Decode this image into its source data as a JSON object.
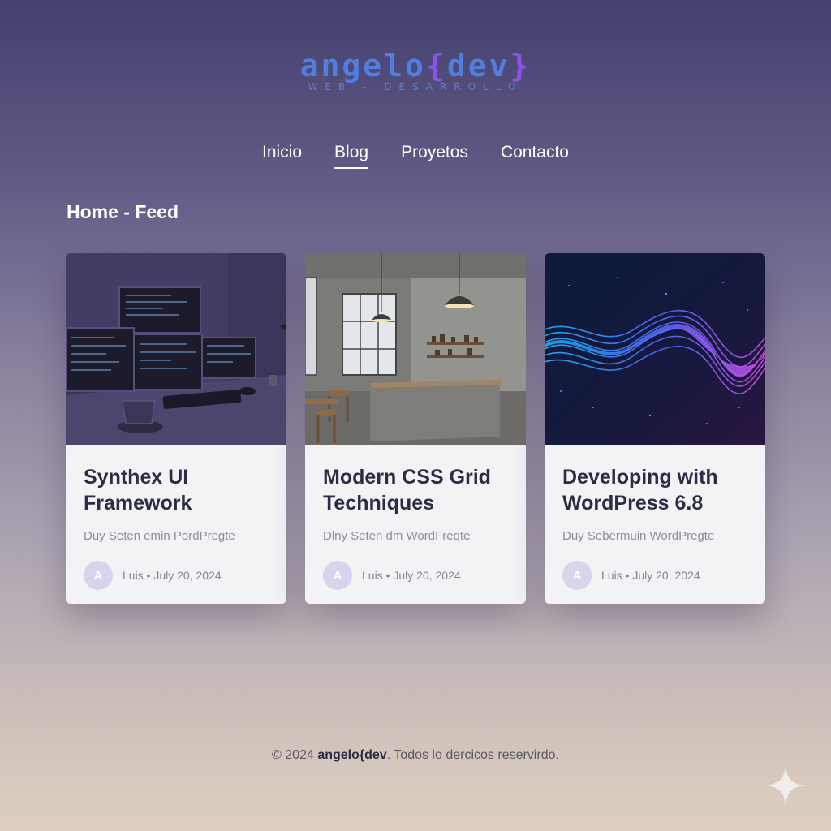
{
  "logo": {
    "name": "angelo",
    "brace_open": "{",
    "accent": "dev",
    "brace_close": "}",
    "tagline": "WEB - DESARROLLO"
  },
  "nav": {
    "items": [
      {
        "label": "Inicio",
        "active": false
      },
      {
        "label": "Blog",
        "active": true
      },
      {
        "label": "Proyetos",
        "active": false
      },
      {
        "label": "Contacto",
        "active": false
      }
    ]
  },
  "section_title": "Home - Feed",
  "cards": [
    {
      "title": "Synthex UI Framework",
      "excerpt": "Duy Seten emin PordPregte",
      "avatar": "A",
      "meta": "Luis • July 20, 2024",
      "image": "desk-monitors"
    },
    {
      "title": "Modern CSS Grid Techniques",
      "excerpt": "Dlny Seten dm WordFreqte",
      "avatar": "A",
      "meta": "Luis • July 20, 2024",
      "image": "concrete-kitchen"
    },
    {
      "title": "Developing with WordPress 6.8",
      "excerpt": "Duy Sebermuin WordPregte",
      "avatar": "A",
      "meta": "Luis • July 20, 2024",
      "image": "particle-wave"
    }
  ],
  "footer": {
    "prefix": "© 2024",
    "brand": "angelo{dev",
    "suffix": ". Todos lo dercicos reservirdo."
  },
  "colors": {
    "logo_blue": "#4f7fe3",
    "logo_purple": "#8a55e6",
    "title_dark": "#2a2d45",
    "avatar_bg": "#d8d4ec"
  },
  "icons": {
    "corner": "sparkle-icon"
  }
}
